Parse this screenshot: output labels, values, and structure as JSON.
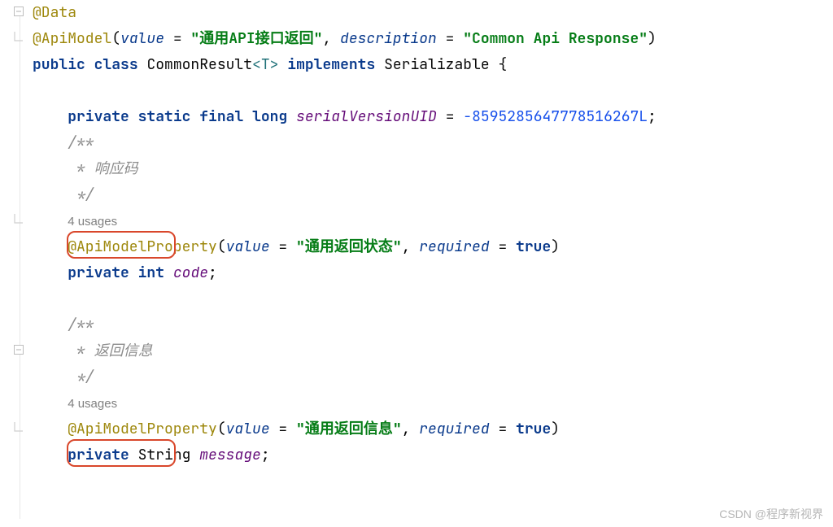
{
  "annotations": {
    "data": "@Data",
    "apiModel": "@ApiModel",
    "apiModelProp": "@ApiModelProperty"
  },
  "apiModelArgs": {
    "valueKey": "value",
    "valueStr": "\"通用API接口返回\"",
    "descKey": "description",
    "descStr": "\"Common Api Response\""
  },
  "classDecl": {
    "public": "public",
    "class": "class",
    "name": "CommonResult",
    "generic": "<T>",
    "implements": "implements",
    "iface": "Serializable",
    "brace": "{"
  },
  "serialLine": {
    "private": "private",
    "static": "static",
    "final": "final",
    "type": "long",
    "name": "serialVersionUID",
    "eq": " = ",
    "val": "-8595285647778516267L",
    "semi": ";"
  },
  "doc1": {
    "open": "/**",
    "body": " * 响应码",
    "close": " */"
  },
  "usages1": "4 usages",
  "prop1": {
    "valueKey": "value",
    "valueStr": "\"通用返回状态\"",
    "reqKey": "required",
    "reqVal": "true"
  },
  "field1": {
    "private": "private",
    "type": "int",
    "name": "code",
    "semi": ";"
  },
  "doc2": {
    "open": "/**",
    "body": " * 返回信息",
    "close": " */"
  },
  "usages2": "4 usages",
  "prop2": {
    "valueKey": "value",
    "valueStr": "\"通用返回信息\"",
    "reqKey": "required",
    "reqVal": "true"
  },
  "field2": {
    "private": "private",
    "type": "String",
    "name": "message",
    "semi": ";"
  },
  "watermark": "CSDN @程序新视界"
}
